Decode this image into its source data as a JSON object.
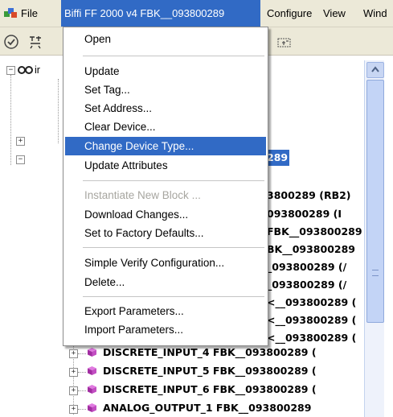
{
  "menubar": {
    "items": [
      {
        "label": "File"
      },
      {
        "label": "Biffi FF 2000 v4  FBK__093800289"
      },
      {
        "label": "Configure"
      },
      {
        "label": "View"
      },
      {
        "label": "Wind"
      }
    ]
  },
  "dropdown": {
    "items": [
      {
        "label": "Open",
        "state": "normal"
      },
      {
        "label": "Update",
        "state": "normal"
      },
      {
        "label": "Set Tag...",
        "state": "normal"
      },
      {
        "label": "Set Address...",
        "state": "normal"
      },
      {
        "label": "Clear Device...",
        "state": "normal"
      },
      {
        "label": "Change Device Type...",
        "state": "highlighted"
      },
      {
        "label": "Update Attributes",
        "state": "normal"
      },
      {
        "label": "Instantiate New Block ...",
        "state": "disabled"
      },
      {
        "label": "Download Changes...",
        "state": "normal"
      },
      {
        "label": "Set to Factory Defaults...",
        "state": "normal"
      },
      {
        "label": "Simple Verify Configuration...",
        "state": "normal"
      },
      {
        "label": "Delete...",
        "state": "normal"
      },
      {
        "label": "Export Parameters...",
        "state": "normal"
      },
      {
        "label": "Import Parameters...",
        "state": "normal"
      }
    ]
  },
  "tree": {
    "root_label": "ir",
    "selected_fragment": "289",
    "visible_fragments": [
      "3800289 (RB2)",
      "093800289 (I",
      "FBK__093800289 (",
      "BK__093800289",
      "_093800289 (/",
      "_093800289 (/",
      "<__093800289 (",
      "<__093800289 (",
      "<__093800289 ("
    ],
    "blocks": [
      "DISCRETE_INPUT_4  FBK__093800289 (",
      "DISCRETE_INPUT_5  FBK__093800289 (",
      "DISCRETE_INPUT_6  FBK__093800289 (",
      "ANALOG_OUTPUT_1  FBK__093800289"
    ]
  },
  "colors": {
    "highlight": "#316ac5",
    "menubar_bg": "#ece9d8",
    "cube_purple": "#b03fb0"
  },
  "icons": [
    "app-icon",
    "check-circle-icon",
    "toolbar-tool-icon",
    "toolbar-expand-icon",
    "network-icon",
    "function-block-icon",
    "scroll-up-icon"
  ]
}
